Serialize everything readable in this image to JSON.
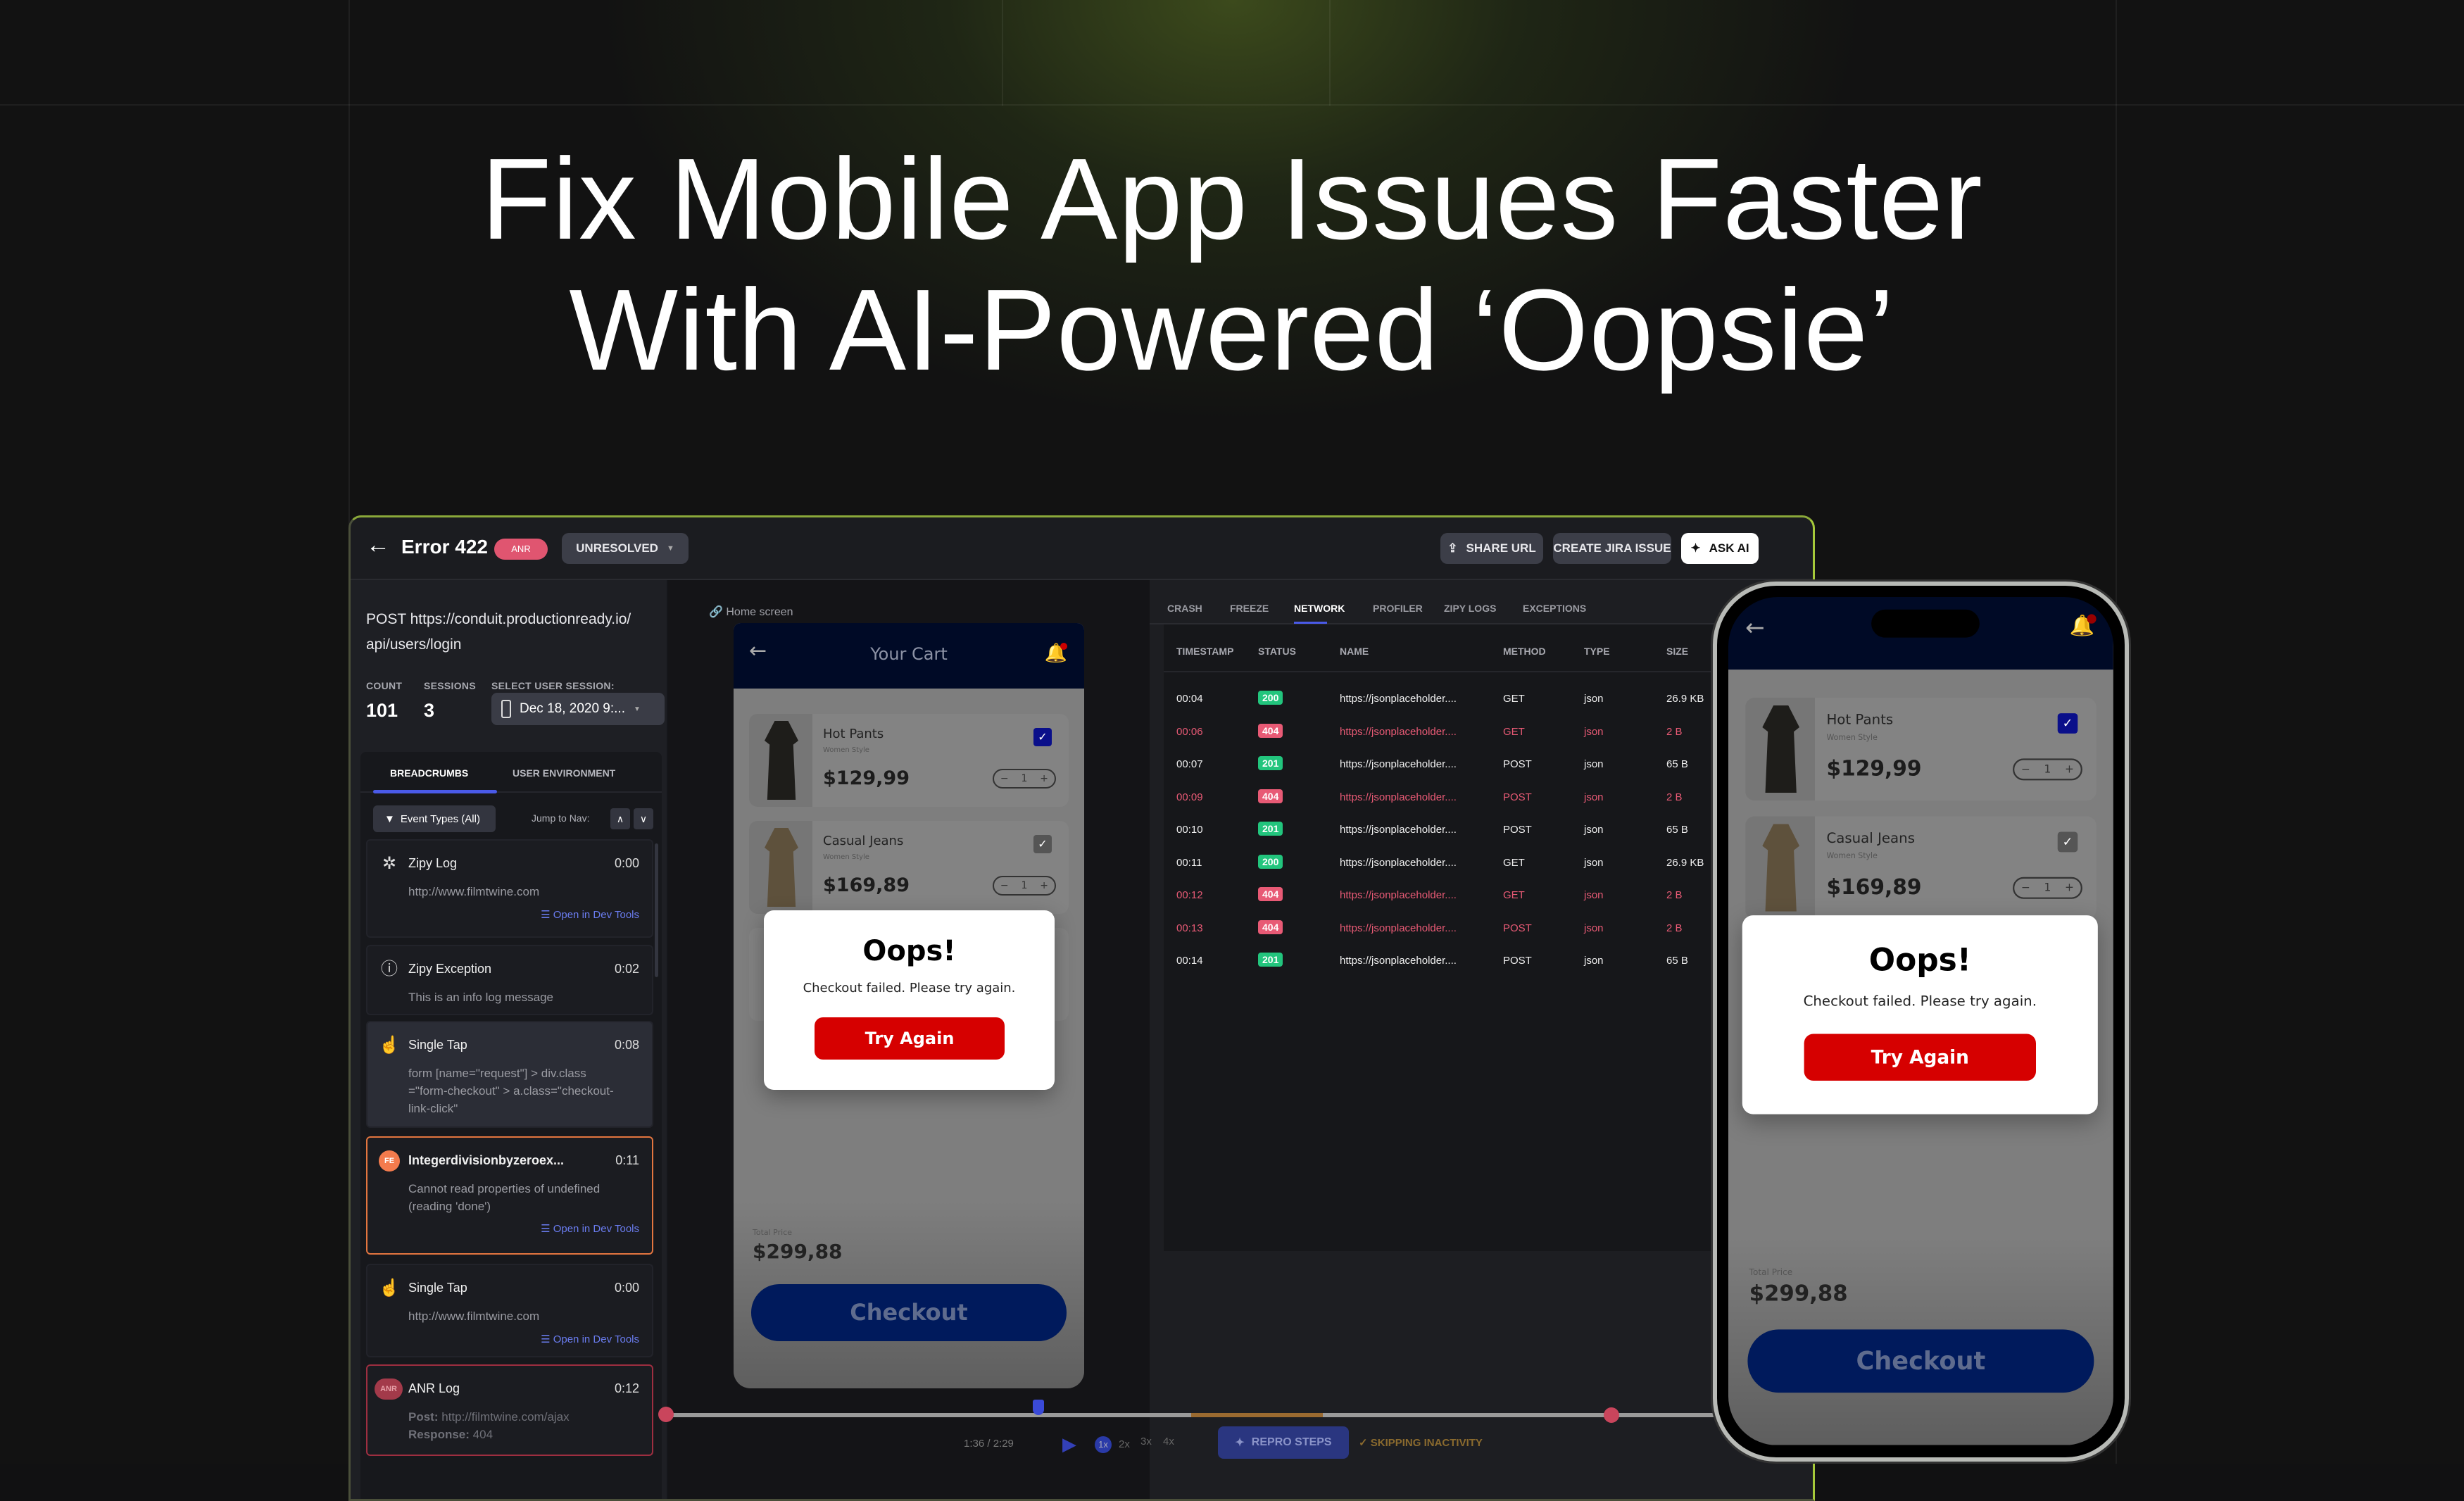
{
  "headline": {
    "line1": "Fix Mobile App Issues Faster",
    "line2": "With AI-Powered ‘Oopsie’"
  },
  "header": {
    "title": "Error 422",
    "badge": "ANR",
    "status": "UNRESOLVED",
    "share": "SHARE URL",
    "jira": "CREATE JIRA ISSUE",
    "ask_ai": "ASK AI"
  },
  "left": {
    "endpoint_line1": "POST https://conduit.productionready.io/",
    "endpoint_line2": "api/users/login",
    "count_label": "COUNT",
    "count": "101",
    "sessions_label": "SESSIONS",
    "sessions": "3",
    "session_label": "SELECT USER SESSION:",
    "session_value": "Dec 18, 2020 9:...",
    "tabs": [
      "BREADCRUMBS",
      "USER ENVIRONMENT"
    ],
    "filter": "Event Types (All)",
    "jump": "Jump to Nav:",
    "dev_tools": "Open in Dev Tools",
    "events": [
      {
        "title": "Zipy Log",
        "time": "0:00",
        "desc": "http://www.filmtwine.com"
      },
      {
        "title": "Zipy Exception",
        "time": "0:02",
        "desc": "This is an info log message"
      },
      {
        "title": "Single Tap",
        "time": "0:08",
        "desc": "form [name=\"request\"] > div.class =\"form-checkout\" > a.class=\"checkout-link-click\""
      },
      {
        "title": "Integerdivisionbyzeroex...",
        "time": "0:11",
        "desc": "Cannot read properties of undefined (reading 'done')",
        "badge": "FE"
      },
      {
        "title": "Single Tap",
        "time": "0:00",
        "desc": "http://www.filmtwine.com"
      },
      {
        "title": "ANR Log",
        "time": "0:12",
        "badge": "ANR",
        "post_label": "Post:",
        "post": "http://filmtwine.com/ajax",
        "resp_label": "Response:",
        "resp": "404"
      }
    ]
  },
  "player": {
    "screen": "Home screen",
    "time": "1:36 / 2:29",
    "speeds": [
      "1x",
      "2x",
      "3x",
      "4x"
    ],
    "repro": "REPRO STEPS",
    "skipping": "SKIPPING INACTIVITY"
  },
  "app": {
    "title": "Your Cart",
    "items": [
      {
        "name": "Hot Pants",
        "style": "Women Style",
        "price": "$129,99",
        "qty": "1"
      },
      {
        "name": "Casual Jeans",
        "style": "Women Style",
        "price": "$169,89",
        "qty": "1"
      }
    ],
    "modal": {
      "title": "Oops!",
      "message": "Checkout failed. Please try again.",
      "button": "Try Again"
    },
    "total_label": "Total Price",
    "total": "$299,88",
    "checkout": "Checkout"
  },
  "network": {
    "tabs": [
      "CRASH",
      "FREEZE",
      "NETWORK",
      "PROFILER",
      "ZIPY LOGS",
      "EXCEPTIONS"
    ],
    "active_tab": "NETWORK",
    "columns": [
      "TIMESTAMP",
      "STATUS",
      "NAME",
      "METHOD",
      "TYPE",
      "SIZE"
    ],
    "rows": [
      [
        "00:04",
        "200",
        "https://jsonplaceholder....",
        "GET",
        "json",
        "26.9 KB"
      ],
      [
        "00:06",
        "404",
        "https://jsonplaceholder....",
        "GET",
        "json",
        "2 B"
      ],
      [
        "00:07",
        "201",
        "https://jsonplaceholder....",
        "POST",
        "json",
        "65 B"
      ],
      [
        "00:09",
        "404",
        "https://jsonplaceholder....",
        "POST",
        "json",
        "2 B"
      ],
      [
        "00:10",
        "201",
        "https://jsonplaceholder....",
        "POST",
        "json",
        "65 B"
      ],
      [
        "00:11",
        "200",
        "https://jsonplaceholder....",
        "GET",
        "json",
        "26.9 KB"
      ],
      [
        "00:12",
        "404",
        "https://jsonplaceholder....",
        "GET",
        "json",
        "2 B"
      ],
      [
        "00:13",
        "404",
        "https://jsonplaceholder....",
        "POST",
        "json",
        "2 B"
      ],
      [
        "00:14",
        "201",
        "https://jsonplaceholder....",
        "POST",
        "json",
        "65 B"
      ]
    ]
  },
  "colors": {
    "ok": "#22c57d",
    "error": "#e85a75",
    "accent": "#4a5ae8",
    "brand_green": "#a6c93a",
    "danger": "#d60000",
    "navy": "#001a5c"
  }
}
